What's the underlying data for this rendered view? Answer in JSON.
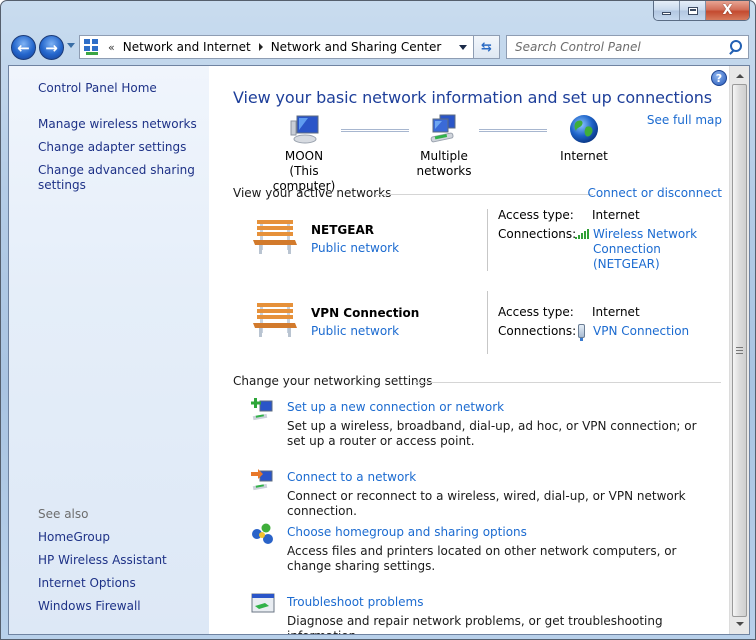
{
  "window": {
    "caption_buttons": {
      "minimize": "minimize",
      "maximize": "maximize",
      "close": "X"
    }
  },
  "navbar": {
    "back_label": "Back",
    "forward_label": "Forward",
    "breadcrumb_overflow": "«",
    "breadcrumbs": [
      "Network and Internet",
      "Network and Sharing Center"
    ],
    "search_placeholder": "Search Control Panel"
  },
  "sidebar": {
    "home": "Control Panel Home",
    "tasks": [
      "Manage wireless networks",
      "Change adapter settings",
      "Change advanced sharing\nsettings"
    ],
    "see_also_heading": "See also",
    "see_also": [
      "HomeGroup",
      "HP Wireless Assistant",
      "Internet Options",
      "Windows Firewall"
    ]
  },
  "main": {
    "help_glyph": "?",
    "title": "View your basic network information and set up connections",
    "see_full_map": "See full map",
    "map_nodes": [
      {
        "label": "MOON",
        "sublabel": "(This computer)",
        "icon": "computer-icon"
      },
      {
        "label": "Multiple networks",
        "sublabel": "",
        "icon": "multiple-networks-icon"
      },
      {
        "label": "Internet",
        "sublabel": "",
        "icon": "globe-icon"
      }
    ],
    "active_networks": {
      "heading": "View your active networks",
      "link": "Connect or disconnect",
      "access_type_label": "Access type:",
      "connections_label": "Connections:",
      "networks": [
        {
          "name": "NETGEAR",
          "type": "Public network",
          "access_type": "Internet",
          "connection": "Wireless Network\nConnection\n(NETGEAR)",
          "connection_icon": "wireless-signal-icon"
        },
        {
          "name": "VPN Connection",
          "type": "Public network",
          "access_type": "Internet",
          "connection": "VPN Connection",
          "connection_icon": "vpn-icon"
        }
      ]
    },
    "settings": {
      "heading": "Change your networking settings",
      "tasks": [
        {
          "link": "Set up a new connection or network",
          "desc": "Set up a wireless, broadband, dial-up, ad hoc, or VPN connection; or set up a router or access point.",
          "icon": "new-connection-icon"
        },
        {
          "link": "Connect to a network",
          "desc": "Connect or reconnect to a wireless, wired, dial-up, or VPN network connection.",
          "icon": "connect-network-icon"
        },
        {
          "link": "Choose homegroup and sharing options",
          "desc": "Access files and printers located on other network computers, or change sharing settings.",
          "icon": "homegroup-icon"
        },
        {
          "link": "Troubleshoot problems",
          "desc": "Diagnose and repair network problems, or get troubleshooting information.",
          "icon": "troubleshoot-icon"
        }
      ]
    }
  },
  "colors": {
    "link": "#1c6bd0",
    "title": "#1e3f9a",
    "sidebar_link": "#1e3287"
  }
}
